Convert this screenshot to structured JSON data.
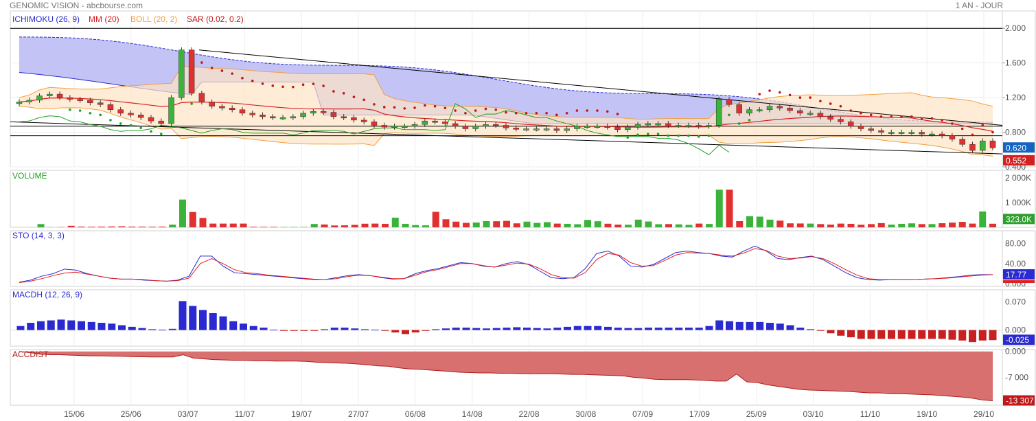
{
  "header": {
    "title": "GENOMIC VISION - abcbourse.com",
    "period": "1 AN - JOUR"
  },
  "colors": {
    "up": "#3bb33b",
    "down": "#e03030",
    "ichimoku": "#2a2ad0",
    "ichimoku_cloud": "#b8b8f5",
    "mm": "#d42020",
    "boll": "#f0a040",
    "boll_fill": "#fde4c4",
    "sar": "#c01818",
    "chikou": "#20a020",
    "volume_label": "#20a020",
    "accdist": "#b01818",
    "accdist_fill": "#d97070",
    "macd_pos": "#2a2ad0",
    "macd_neg": "#c82020",
    "sto_k": "#2a2ad0",
    "sto_d": "#e02020"
  },
  "x_labels": [
    "15/06",
    "25/06",
    "03/07",
    "11/07",
    "19/07",
    "27/07",
    "06/08",
    "14/08",
    "22/08",
    "30/08",
    "07/09",
    "17/09",
    "25/09",
    "03/10",
    "11/10",
    "19/10",
    "29/10"
  ],
  "panels": {
    "price": {
      "labels": [
        {
          "text": "ICHIMOKU (26, 9)",
          "color": "#2a2ad0"
        },
        {
          "text": "MM (20)",
          "color": "#d42020"
        },
        {
          "text": "BOLL (20, 2)",
          "color": "#f0a040"
        },
        {
          "text": "SAR (0.02, 0.2)",
          "color": "#c01818"
        }
      ],
      "ticks": [
        "2.000",
        "1.600",
        "1.200",
        "0.800",
        "0.400"
      ],
      "tags": [
        {
          "text": "0.620",
          "color": "#1565c0"
        },
        {
          "text": "0.552",
          "color": "#d42020"
        }
      ]
    },
    "volume": {
      "label": "VOLUME",
      "ticks": [
        "2 000K",
        "1 000K"
      ],
      "tags": [
        {
          "text": "323.0K",
          "color": "#2e9e2e"
        }
      ]
    },
    "sto": {
      "label": "STO (14, 3, 3)",
      "ticks": [
        "80.00",
        "40.00",
        "0.000"
      ],
      "tags": [
        {
          "text": "17.77",
          "color": "#2a2ad0"
        }
      ]
    },
    "macdh": {
      "label": "MACDH (12, 26, 9)",
      "ticks": [
        "0.070",
        "0.000"
      ],
      "tags": [
        {
          "text": "-0.025",
          "color": "#2a2ad0"
        }
      ]
    },
    "accdist": {
      "label": "ACCDIST",
      "ticks": [
        "0.000",
        "-7 000",
        "-13 307"
      ],
      "tags": [
        {
          "text": "-13 307",
          "color": "#c01818"
        }
      ]
    }
  },
  "chart_data": [
    {
      "type": "candlestick",
      "title": "GENOMIC VISION - abcbourse.com",
      "ylim": [
        0.4,
        2.2
      ],
      "candles_close": [
        1.15,
        1.17,
        1.22,
        1.24,
        1.2,
        1.18,
        1.17,
        1.14,
        1.12,
        1.06,
        1.02,
        1.0,
        0.97,
        0.93,
        0.9,
        1.2,
        1.75,
        1.25,
        1.15,
        1.1,
        1.08,
        1.06,
        1.02,
        1.0,
        0.98,
        0.97,
        0.97,
        0.98,
        1.02,
        1.04,
        1.03,
        0.98,
        0.97,
        0.94,
        0.92,
        0.88,
        0.86,
        0.87,
        0.87,
        0.89,
        0.93,
        0.92,
        0.9,
        0.87,
        0.84,
        0.87,
        0.89,
        0.88,
        0.85,
        0.84,
        0.84,
        0.84,
        0.84,
        0.82,
        0.84,
        0.87,
        0.87,
        0.87,
        0.86,
        0.83,
        0.86,
        0.89,
        0.9,
        0.9,
        0.88,
        0.88,
        0.88,
        0.87,
        0.88,
        1.18,
        1.12,
        1.02,
        1.06,
        1.06,
        1.1,
        1.08,
        1.05,
        1.02,
        1.02,
        0.98,
        0.95,
        0.92,
        0.87,
        0.84,
        0.82,
        0.8,
        0.8,
        0.8,
        0.8,
        0.78,
        0.78,
        0.76,
        0.72,
        0.66,
        0.59,
        0.7,
        0.62
      ],
      "indicators": [
        "ICHIMOKU (26, 9)",
        "MM (20)",
        "BOLL (20, 2)",
        "SAR (0.02, 0.2)"
      ],
      "last": 0.62
    },
    {
      "type": "bar",
      "title": "VOLUME",
      "values_k": [
        2,
        5,
        130,
        8,
        10,
        60,
        30,
        25,
        30,
        35,
        40,
        30,
        30,
        25,
        30,
        110,
        1120,
        620,
        380,
        150,
        150,
        150,
        150,
        25,
        20,
        20,
        15,
        15,
        15,
        135,
        115,
        75,
        80,
        100,
        145,
        150,
        140,
        390,
        140,
        90,
        80,
        625,
        325,
        230,
        180,
        195,
        250,
        245,
        260,
        160,
        230,
        180,
        210,
        150,
        140,
        125,
        300,
        245,
        145,
        110,
        105,
        310,
        235,
        125,
        130,
        120,
        100,
        150,
        135,
        1520,
        1520,
        250,
        450,
        430,
        310,
        270,
        160,
        155,
        150,
        130,
        110,
        150,
        140,
        105,
        130,
        170,
        110,
        140,
        160,
        130,
        130,
        165,
        190,
        220,
        150,
        640,
        145
      ],
      "ylim_k": [
        0,
        2300
      ],
      "last": "323.0K"
    },
    {
      "type": "line",
      "title": "STO (14, 3, 3)",
      "series": [
        {
          "values": [
            3,
            7,
            15,
            20,
            29,
            27,
            20,
            15,
            11,
            9,
            9,
            7,
            6,
            5,
            7,
            15,
            55,
            55,
            35,
            22,
            20,
            18,
            16,
            14,
            12,
            10,
            8,
            8,
            12,
            16,
            18,
            16,
            12,
            9,
            10,
            20,
            26,
            30,
            36,
            42,
            40,
            35,
            33,
            40,
            44,
            38,
            25,
            12,
            10,
            12,
            30,
            60,
            65,
            55,
            35,
            33,
            38,
            50,
            62,
            65,
            62,
            60,
            55,
            53,
            65,
            75,
            65,
            50,
            48,
            52,
            55,
            48,
            35,
            22,
            12,
            8,
            7,
            8,
            8,
            8,
            9,
            10,
            12,
            14,
            17,
            18,
            18
          ]
        },
        {
          "values": [
            2,
            5,
            10,
            16,
            21,
            23,
            19,
            15,
            11,
            9,
            9,
            8,
            6,
            5,
            6,
            11,
            40,
            50,
            40,
            28,
            22,
            20,
            17,
            15,
            13,
            11,
            9,
            8,
            10,
            14,
            17,
            16,
            13,
            10,
            10,
            17,
            24,
            28,
            34,
            40,
            40,
            36,
            33,
            37,
            41,
            39,
            30,
            18,
            12,
            11,
            22,
            48,
            60,
            57,
            42,
            35,
            36,
            46,
            57,
            62,
            61,
            60,
            57,
            55,
            61,
            70,
            66,
            55,
            50,
            51,
            54,
            50,
            40,
            28,
            17,
            10,
            8,
            8,
            8,
            8,
            9,
            10,
            11,
            13,
            15,
            17,
            18
          ]
        }
      ],
      "ylim": [
        0,
        100
      ],
      "last": 17.77
    },
    {
      "type": "bar",
      "title": "MACDH (12, 26, 9)",
      "values": [
        0.01,
        0.018,
        0.022,
        0.024,
        0.026,
        0.024,
        0.022,
        0.02,
        0.018,
        0.016,
        0.012,
        0.008,
        0.005,
        0.002,
        0.001,
        0.003,
        0.072,
        0.06,
        0.05,
        0.042,
        0.034,
        0.022,
        0.016,
        0.01,
        0.006,
        0.001,
        -0.002,
        -0.002,
        -0.002,
        -0.002,
        0.002,
        0.006,
        0.006,
        0.004,
        0.002,
        0.001,
        -0.002,
        -0.006,
        -0.01,
        -0.006,
        -0.002,
        0.002,
        0.004,
        0.006,
        0.006,
        0.005,
        0.004,
        0.005,
        0.006,
        0.007,
        0.006,
        0.005,
        0.004,
        0.006,
        0.008,
        0.01,
        0.01,
        0.01,
        0.008,
        0.006,
        0.005,
        0.005,
        0.006,
        0.006,
        0.006,
        0.006,
        0.006,
        0.006,
        0.01,
        0.024,
        0.022,
        0.02,
        0.02,
        0.02,
        0.018,
        0.016,
        0.012,
        0.006,
        0.002,
        -0.002,
        -0.008,
        -0.014,
        -0.018,
        -0.022,
        -0.022,
        -0.022,
        -0.022,
        -0.022,
        -0.022,
        -0.022,
        -0.022,
        -0.022,
        -0.024,
        -0.026,
        -0.03,
        -0.026,
        -0.025
      ],
      "ylim": [
        -0.04,
        0.1
      ],
      "last": -0.025
    },
    {
      "type": "area",
      "title": "ACCDIST",
      "values": [
        0,
        -300,
        -700,
        -900,
        -900,
        -1000,
        -1100,
        -1200,
        -1200,
        -1250,
        -1300,
        -1400,
        -1450,
        -1500,
        -1500,
        -1500,
        -900,
        -1800,
        -2000,
        -2200,
        -2300,
        -2400,
        -2400,
        -2500,
        -2500,
        -2600,
        -2600,
        -2600,
        -2700,
        -2900,
        -3000,
        -3100,
        -3200,
        -3400,
        -3600,
        -3900,
        -4000,
        -4400,
        -4700,
        -4800,
        -5000,
        -5200,
        -5400,
        -5600,
        -5700,
        -5800,
        -5800,
        -5900,
        -5900,
        -6000,
        -6000,
        -6000,
        -6000,
        -6100,
        -6200,
        -6200,
        -6300,
        -6400,
        -6500,
        -6600,
        -7000,
        -7200,
        -7500,
        -7600,
        -7600,
        -7600,
        -7700,
        -7800,
        -8000,
        -8000,
        -6100,
        -8200,
        -8400,
        -9000,
        -9400,
        -9800,
        -10200,
        -10400,
        -10500,
        -10600,
        -10700,
        -10800,
        -11000,
        -11200,
        -11200,
        -11400,
        -11400,
        -11500,
        -11600,
        -11700,
        -11900,
        -12100,
        -12300,
        -12600,
        -13100,
        -13307
      ],
      "ylim": [
        -14500,
        500
      ],
      "last": -13307
    }
  ]
}
